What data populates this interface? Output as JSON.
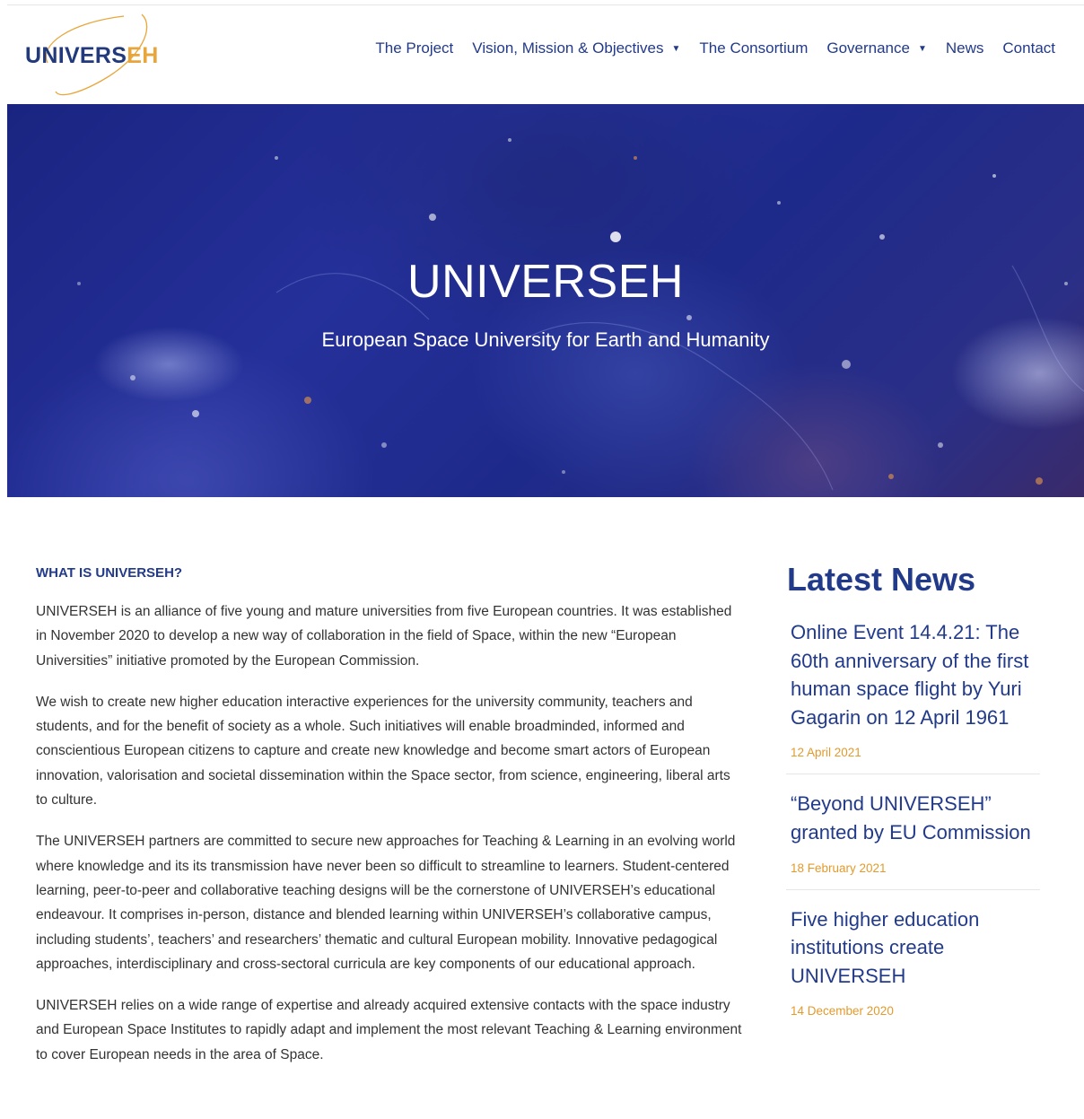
{
  "brand": {
    "logo_main": "UNIVERS",
    "logo_accent": "EH",
    "accent_color": "#e8a63a",
    "primary_color": "#223a8a"
  },
  "nav": {
    "items": [
      {
        "label": "The Project",
        "has_dropdown": false
      },
      {
        "label": "Vision, Mission & Objectives",
        "has_dropdown": true
      },
      {
        "label": "The Consortium",
        "has_dropdown": false
      },
      {
        "label": "Governance",
        "has_dropdown": true
      },
      {
        "label": "News",
        "has_dropdown": false
      },
      {
        "label": "Contact",
        "has_dropdown": false
      }
    ],
    "caret_icon": "caret-down-icon"
  },
  "hero": {
    "title": "UNIVERSEH",
    "subtitle": "European Space University for Earth and Humanity"
  },
  "main": {
    "heading": "WHAT IS UNIVERSEH?",
    "paragraphs": [
      "UNIVERSEH is an alliance of five young and mature universities from five European countries. It was established in November 2020 to develop a new way of collaboration in the field of Space, within the new “European Universities” initiative promoted by the European Commission.",
      "We wish to create new higher education interactive experiences for the university community, teachers and students, and for the benefit of society as a whole. Such initiatives will enable broadminded, informed and conscientious European citizens to capture and create new knowledge and become smart actors of European innovation, valorisation and societal dissemination within the Space sector, from science, engineering, liberal arts to culture.",
      "The UNIVERSEH partners are committed to secure new approaches for Teaching & Learning in an evolving world where knowledge and its its transmission have never been so difficult to streamline to learners. Student-centered learning, peer-to-peer and collaborative teaching designs will be the cornerstone of UNIVERSEH’s educational endeavour. It comprises in-person, distance and blended learning within UNIVERSEH’s collaborative campus, including students’, teachers’ and researchers’ thematic and cultural European mobility. Innovative pedagogical approaches, interdisciplinary and cross-sectoral curricula are key components of our educational approach.",
      "UNIVERSEH relies on a wide range of expertise and already acquired extensive contacts with the space industry and European Space Institutes to rapidly adapt and implement the most relevant Teaching & Learning environment to cover European needs in the area of Space."
    ]
  },
  "sidebar": {
    "title": "Latest News",
    "news": [
      {
        "title": "Online Event 14.4.21: The 60th anniversary of the first human space flight by Yuri Gagarin on 12 April 1961",
        "date": "12 April 2021"
      },
      {
        "title": "“Beyond UNIVERSEH” granted by EU Commission",
        "date": "18 February 2021"
      },
      {
        "title": "Five higher education institutions create UNIVERSEH",
        "date": "14 December 2020"
      }
    ]
  }
}
